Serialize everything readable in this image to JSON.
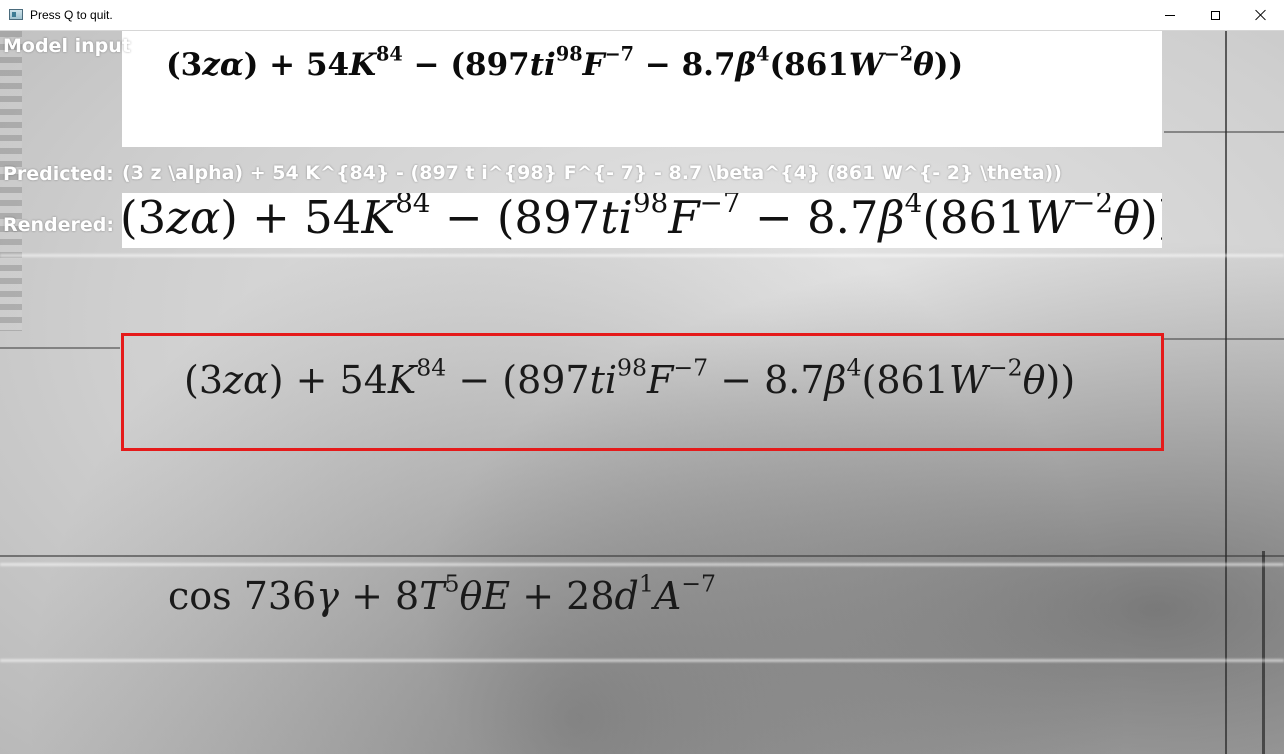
{
  "window": {
    "title": "Press Q to quit."
  },
  "overlay": {
    "model_input_label": "Model input",
    "predicted_label": "Predicted:",
    "predicted_value": "(3 z \\alpha) + 54 K^{84} - (897 t i^{98} F^{- 7} - 8.7 \\beta^{4} (861 W^{- 2} \\theta))",
    "rendered_label": "Rendered:"
  },
  "scene": {
    "detected_expression": "(3zα) + 54K^84 − (897ti^98 F^−7 − 8.7β^4(861W^−2θ))",
    "other_expression": "cos 736γ + 8T^5θE + 28d^1 A^−7",
    "detection_box_color": "#e51a1a"
  },
  "icons": {
    "app": "window-app-icon",
    "minimize": "minimize-icon",
    "maximize": "maximize-icon",
    "close": "close-icon"
  }
}
